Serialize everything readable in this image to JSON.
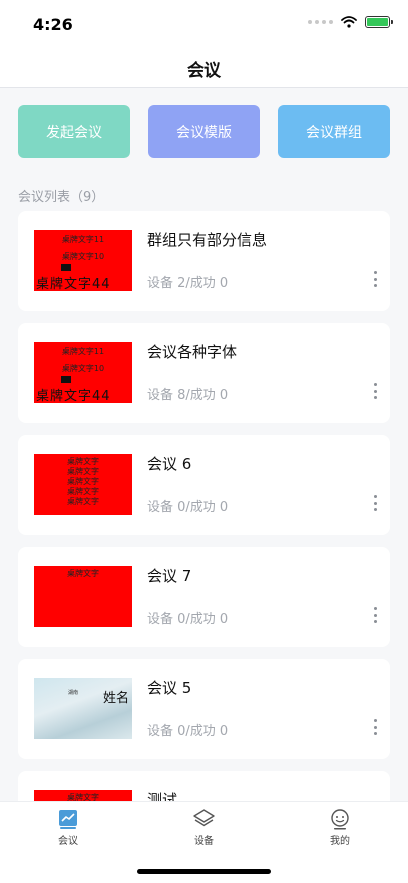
{
  "status_bar": {
    "time": "4:26"
  },
  "nav": {
    "title": "会议"
  },
  "actions": [
    {
      "label": "发起会议"
    },
    {
      "label": "会议模版"
    },
    {
      "label": "会议群组"
    }
  ],
  "list": {
    "header": "会议列表（9）",
    "items": [
      {
        "title": "群组只有部分信息",
        "subtitle": "设备 2/成功 0"
      },
      {
        "title": "会议各种字体",
        "subtitle": "设备 8/成功 0"
      },
      {
        "title": "会议 6",
        "subtitle": "设备 0/成功 0"
      },
      {
        "title": "会议 7",
        "subtitle": "设备 0/成功 0"
      },
      {
        "title": "会议 5",
        "subtitle": "设备 0/成功 0"
      },
      {
        "title": "测试"
      }
    ]
  },
  "thumbs": {
    "line_11": "桌牌文字11",
    "line_10": "桌牌文字10",
    "line_44": "桌牌文字44",
    "line_plain": "桌牌文字",
    "name": "姓名",
    "small": "湖南"
  },
  "tabs": [
    {
      "label": "会议"
    },
    {
      "label": "设备"
    },
    {
      "label": "我的"
    }
  ],
  "colors": {
    "start": "#7fd8c4",
    "template": "#8fa3f4",
    "group": "#6cbcf2",
    "thumb_red": "#ff0000",
    "accent": "#4a9bd8"
  },
  "icons": {
    "wifi": "wifi-icon",
    "battery": "battery-charging-icon",
    "more": "more-vertical-icon",
    "meeting_tab": "chart-icon",
    "device_tab": "layers-icon",
    "mine_tab": "smiley-icon"
  }
}
